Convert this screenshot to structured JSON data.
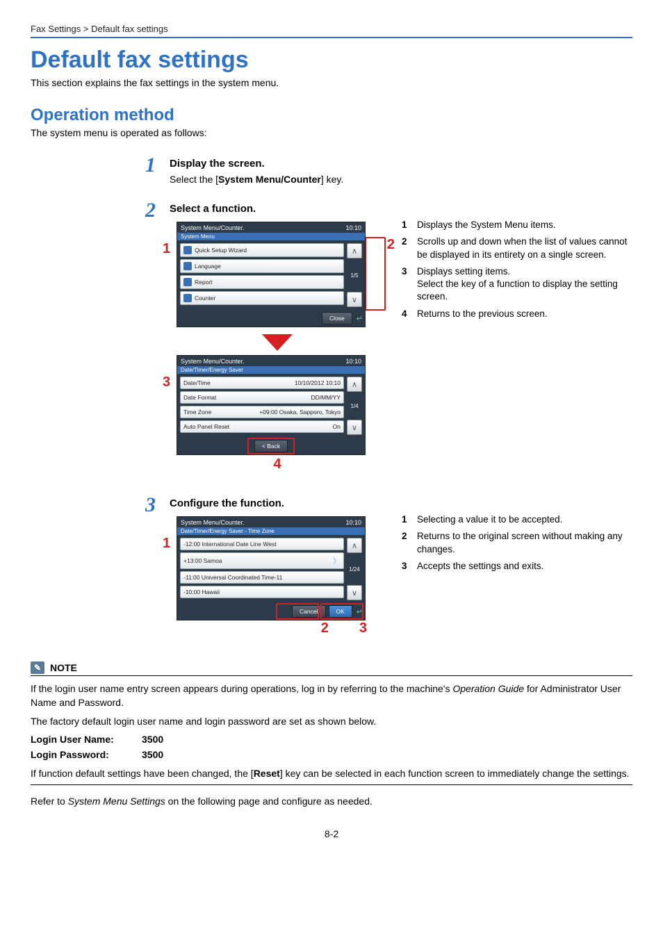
{
  "breadcrumb": "Fax Settings > Default fax settings",
  "page_title": "Default fax settings",
  "intro": "This section explains the fax settings in the system menu.",
  "subtitle": "Operation method",
  "subintro": "The system menu is operated as follows:",
  "steps": {
    "s1": {
      "num": "1",
      "heading": "Display the screen.",
      "line_a": "Select the [",
      "line_b": "System Menu/Counter",
      "line_c": "] key."
    },
    "s2": {
      "num": "2",
      "heading": "Select a function."
    },
    "s3": {
      "num": "3",
      "heading": "Configure the function."
    }
  },
  "screen1": {
    "title": "System Menu/Counter.",
    "time": "10:10",
    "sub": "System Menu",
    "items": {
      "i1": "Quick Setup Wizard",
      "i2": "Language",
      "i3": "Report",
      "i4": "Counter"
    },
    "frac": "1/5",
    "close": "Close"
  },
  "screen2": {
    "title": "System Menu/Counter.",
    "time": "10:10",
    "sub": "Date/Timer/Energy Saver",
    "rows": {
      "r1": {
        "label": "Date/Time",
        "val": "10/10/2012 10:10"
      },
      "r2": {
        "label": "Date Format",
        "val": "DD/MM/YY"
      },
      "r3": {
        "label": "Time Zone",
        "val": "+09:00 Osaka, Sapporo, Tokyo"
      },
      "r4": {
        "label": "Auto Panel Reset",
        "val": "On"
      }
    },
    "frac": "1/4",
    "back": "< Back"
  },
  "screen3": {
    "title": "System Menu/Counter.",
    "time": "10:10",
    "sub": "Date/Timer/Energy Saver - Time Zone",
    "items": {
      "i1": "-12:00 International Date Line West",
      "i2": "+13:00 Samoa",
      "i3": "-11:00 Universal Coordinated Time-11",
      "i4": "-10:00 Hawaii"
    },
    "frac": "1/24",
    "cancel": "Cancel",
    "ok": "OK"
  },
  "legend2": {
    "l1": {
      "n": "1",
      "t": "Displays the System Menu items."
    },
    "l2": {
      "n": "2",
      "t": "Scrolls up and down when the list of values cannot be displayed in its entirety on a single screen."
    },
    "l3": {
      "n": "3",
      "t1": "Displays setting items.",
      "t2": "Select the key of a function to display the setting screen."
    },
    "l4": {
      "n": "4",
      "t": "Returns to the previous screen."
    }
  },
  "legend3": {
    "l1": {
      "n": "1",
      "t": "Selecting a value it to be accepted."
    },
    "l2": {
      "n": "2",
      "t": "Returns to the original screen without making any changes."
    },
    "l3": {
      "n": "3",
      "t": "Accepts the settings and exits."
    }
  },
  "callouts": {
    "c1": "1",
    "c2": "2",
    "c3": "3",
    "c4": "4"
  },
  "note": {
    "heading": "NOTE",
    "p1a": "If the login user name entry screen appears during operations, log in by referring to the machine's ",
    "p1b": "Operation Guide",
    "p1c": " for Administrator User Name and Password.",
    "p2": "The factory default login user name and login password are set as shown below.",
    "cred_user_label": "Login User Name:",
    "cred_user_val": "3500",
    "cred_pass_label": "Login Password:",
    "cred_pass_val": "3500",
    "p3a": "If function default settings have been changed, the [",
    "p3b": "Reset",
    "p3c": "] key can be selected in each function screen to immediately change the settings."
  },
  "closing_a": "Refer to ",
  "closing_b": "System Menu Settings",
  "closing_c": " on the following page and configure as needed.",
  "page_number": "8-2"
}
